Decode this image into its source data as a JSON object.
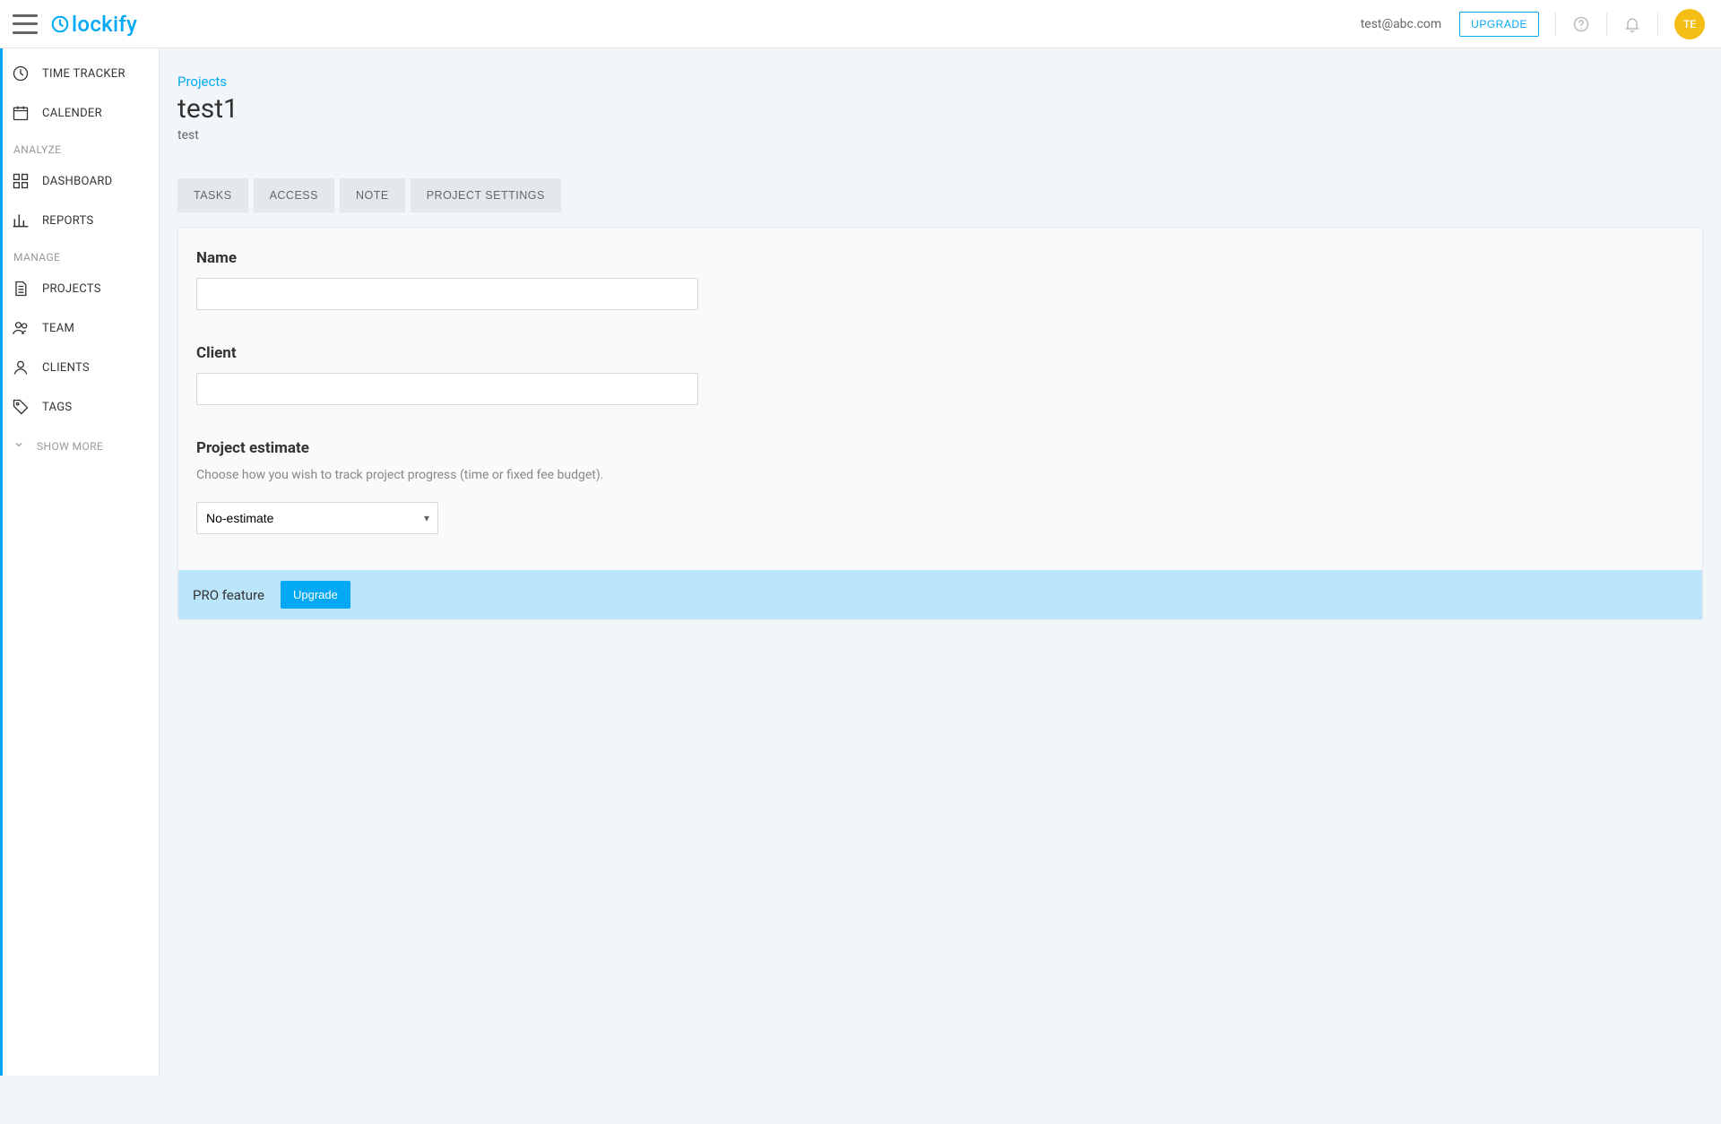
{
  "topbar": {
    "logo_text": "lockify",
    "user_email": "test@abc.com",
    "upgrade_label": "UPGRADE",
    "avatar_initials": "TE"
  },
  "sidebar": {
    "items_top": [
      {
        "label": "TIME TRACKER",
        "icon": "clock"
      },
      {
        "label": "CALENDER",
        "icon": "calendar"
      }
    ],
    "heading_analyze": "ANALYZE",
    "items_analyze": [
      {
        "label": "DASHBOARD",
        "icon": "grid"
      },
      {
        "label": "REPORTS",
        "icon": "bars"
      }
    ],
    "heading_manage": "MANAGE",
    "items_manage": [
      {
        "label": "PROJECTS",
        "icon": "doc"
      },
      {
        "label": "TEAM",
        "icon": "team"
      },
      {
        "label": "CLIENTS",
        "icon": "client"
      },
      {
        "label": "TAGS",
        "icon": "tag"
      }
    ],
    "show_more_label": "SHOW MORE"
  },
  "page": {
    "breadcrumb": "Projects",
    "title": "test1",
    "subtitle": "test",
    "tabs": [
      {
        "label": "TASKS"
      },
      {
        "label": "ACCESS"
      },
      {
        "label": "NOTE"
      },
      {
        "label": "PROJECT SETTINGS"
      }
    ],
    "name_label": "Name",
    "name_value": "",
    "client_label": "Client",
    "client_value": "",
    "estimate_label": "Project estimate",
    "estimate_helper": "Choose how you wish to track project progress (time or fixed fee budget).",
    "estimate_selected": "No-estimate",
    "pro_label": "PRO feature",
    "pro_button": "Upgrade"
  }
}
